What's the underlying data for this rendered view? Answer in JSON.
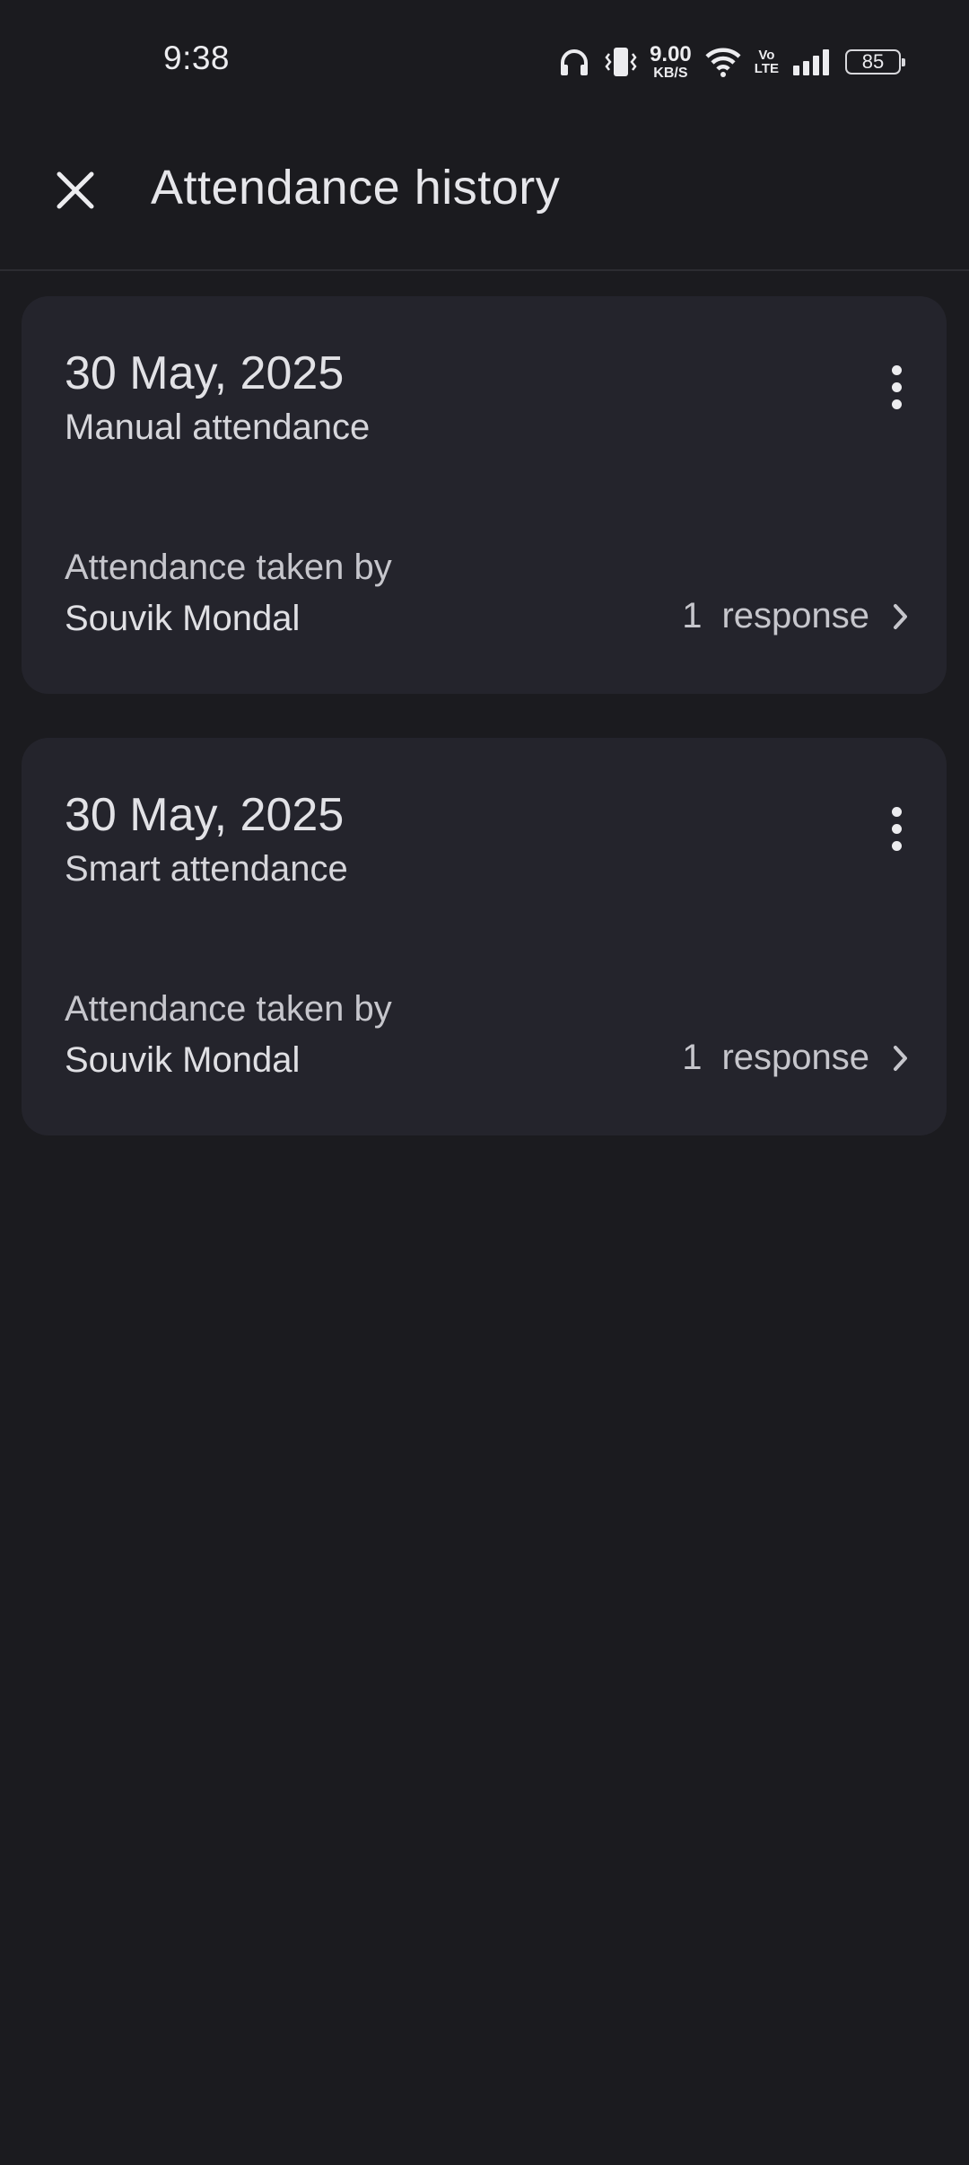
{
  "status_bar": {
    "time": "9:38",
    "net_speed_value": "9.00",
    "net_speed_unit": "KB/S",
    "volte_top": "Vo",
    "volte_bottom": "LTE",
    "battery": "85",
    "icons": [
      "headphones-icon",
      "vibrate-icon",
      "wifi-icon",
      "signal-icon",
      "battery-icon"
    ]
  },
  "app_bar": {
    "title": "Attendance history",
    "close_icon": "close-icon"
  },
  "records": [
    {
      "date": "30 May, 2025",
      "type": "Manual attendance",
      "taken_by_label": "Attendance taken by",
      "taken_by": "Souvik Mondal",
      "response_count": "1",
      "response_label": "response"
    },
    {
      "date": "30 May, 2025",
      "type": "Smart attendance",
      "taken_by_label": "Attendance taken by",
      "taken_by": "Souvik Mondal",
      "response_count": "1",
      "response_label": "response"
    }
  ],
  "colors": {
    "background": "#1b1b1f",
    "card": "#24242c",
    "text_primary": "#e3e3e6",
    "text_secondary": "#c6c6cc"
  }
}
